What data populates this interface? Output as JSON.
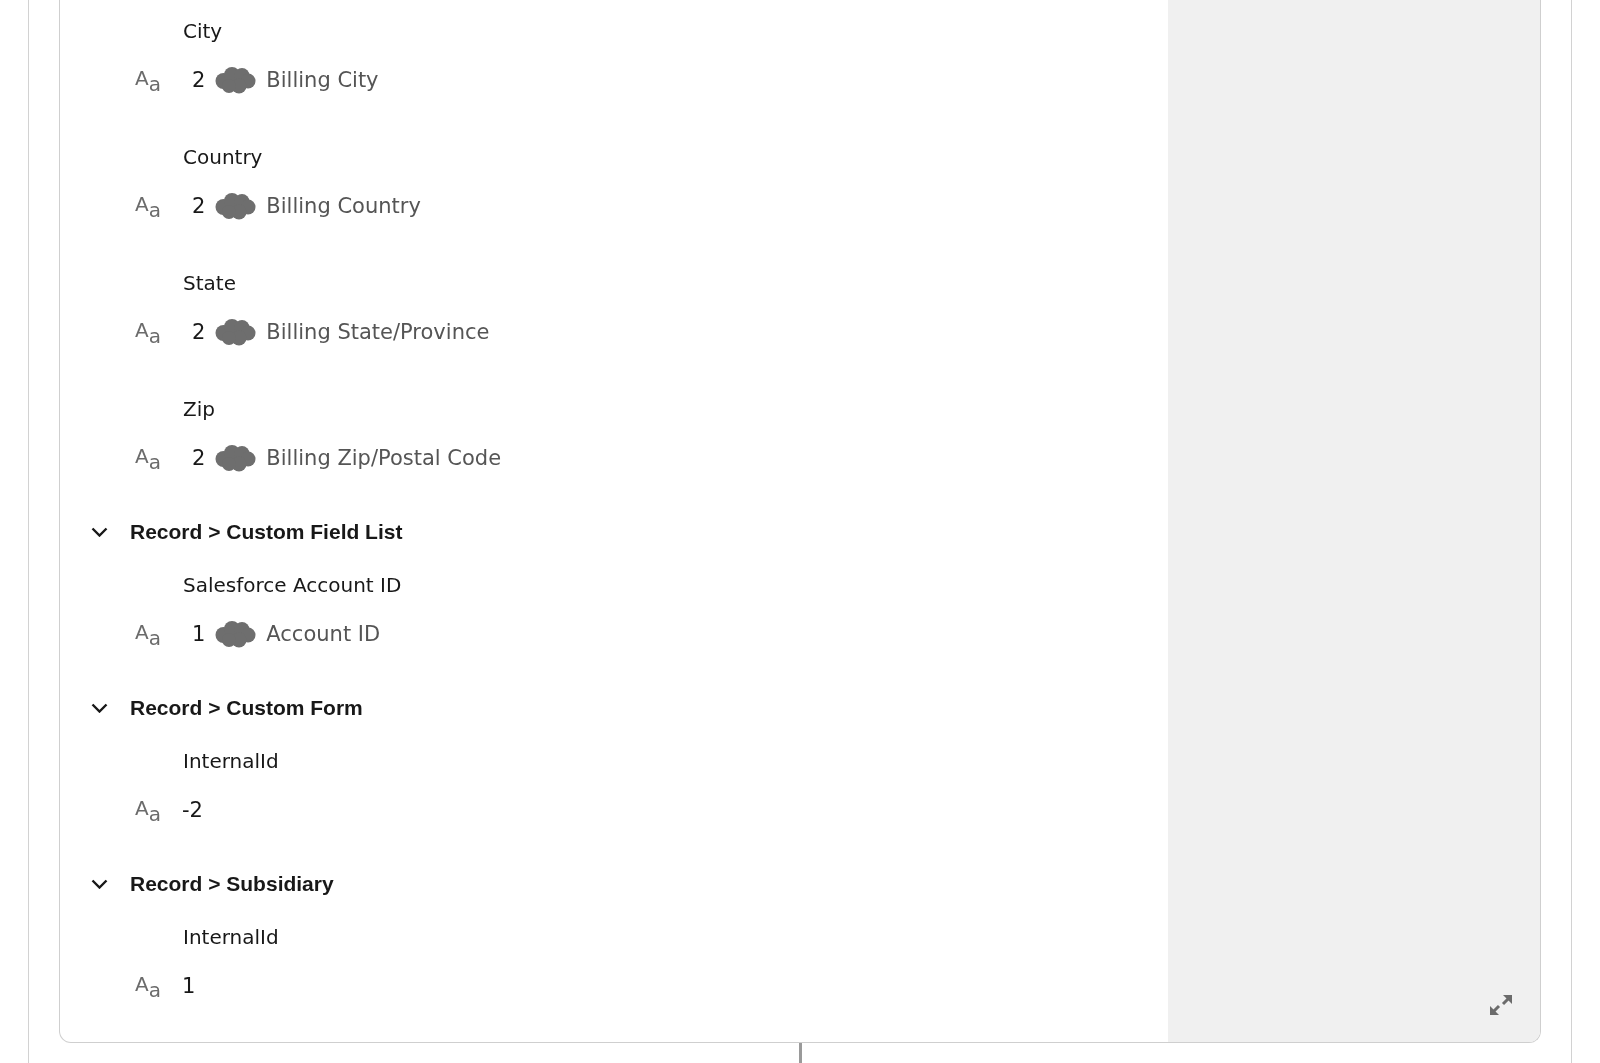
{
  "card": {
    "sections": [
      {
        "fields": [
          {
            "label": "City",
            "value": {
              "kind": "mapped",
              "type_icon": "A$_{a}$",
              "count": "2",
              "source": "Billing City"
            }
          },
          {
            "label": "Country",
            "value": {
              "kind": "mapped",
              "type_icon": "A$_{a}$",
              "count": "2",
              "source": "Billing Country"
            }
          },
          {
            "label": "State",
            "value": {
              "kind": "mapped",
              "type_icon": "A$_{a}$",
              "count": "2",
              "source": "Billing State/Province"
            }
          },
          {
            "label": "Zip",
            "value": {
              "kind": "mapped",
              "type_icon": "A$_{a}$",
              "count": "2",
              "source": "Billing Zip/Postal Code"
            }
          }
        ]
      },
      {
        "title": "Record > Custom Field List",
        "expanded": true,
        "fields": [
          {
            "label": "Salesforce Account ID",
            "value": {
              "kind": "mapped",
              "type_icon": "A$_{a}$",
              "count": "1",
              "source": "Account ID"
            }
          }
        ]
      },
      {
        "title": "Record > Custom Form",
        "expanded": true,
        "fields": [
          {
            "label": "InternalId",
            "value": {
              "kind": "literal",
              "type_icon": "A$_{a}$",
              "text": "-2"
            }
          }
        ]
      },
      {
        "title": "Record > Subsidiary",
        "expanded": true,
        "fields": [
          {
            "label": "InternalId",
            "value": {
              "kind": "literal",
              "type_icon": "A$_{a}$",
              "text": "1"
            }
          }
        ]
      }
    ]
  }
}
